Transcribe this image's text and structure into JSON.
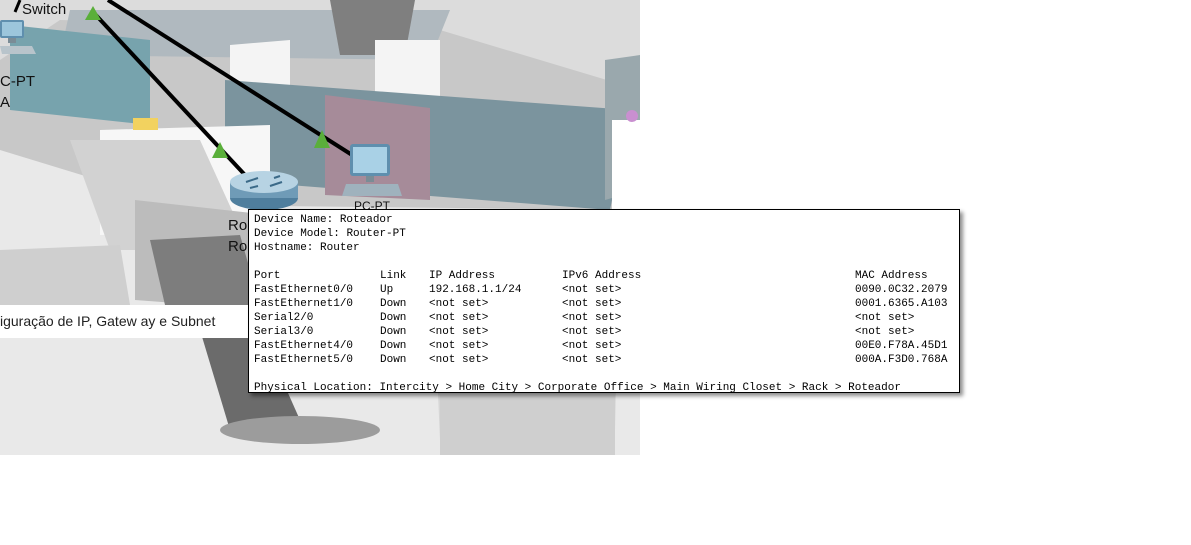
{
  "canvas": {
    "labels": {
      "switch": "Switch",
      "pc_left_line1": "C-PT",
      "pc_left_line2": "A",
      "router_line1": "Ro",
      "router_line2": "Ro",
      "pc_center": "PC-PT"
    },
    "note": "iguração de IP, Gatew ay e Subnet"
  },
  "tooltip": {
    "device_name_label": "Device Name:",
    "device_name": "Roteador",
    "device_model_label": "Device Model:",
    "device_model": "Router-PT",
    "hostname_label": "Hostname:",
    "hostname": "Router",
    "columns": {
      "port": "Port",
      "link": "Link",
      "ip": "IP Address",
      "ipv6": "IPv6 Address",
      "mac": "MAC Address"
    },
    "ports": [
      {
        "port": "FastEthernet0/0",
        "link": "Up",
        "ip": "192.168.1.1/24",
        "ipv6": "<not set>",
        "mac": "0090.0C32.2079"
      },
      {
        "port": "FastEthernet1/0",
        "link": "Down",
        "ip": "<not set>",
        "ipv6": "<not set>",
        "mac": "0001.6365.A103"
      },
      {
        "port": "Serial2/0",
        "link": "Down",
        "ip": "<not set>",
        "ipv6": "<not set>",
        "mac": "<not set>"
      },
      {
        "port": "Serial3/0",
        "link": "Down",
        "ip": "<not set>",
        "ipv6": "<not set>",
        "mac": "<not set>"
      },
      {
        "port": "FastEthernet4/0",
        "link": "Down",
        "ip": "<not set>",
        "ipv6": "<not set>",
        "mac": "00E0.F78A.45D1"
      },
      {
        "port": "FastEthernet5/0",
        "link": "Down",
        "ip": "<not set>",
        "ipv6": "<not set>",
        "mac": "000A.F3D0.768A"
      }
    ],
    "location_label": "Physical Location:",
    "location": "Intercity > Home City > Corporate Office > Main Wiring Closet > Rack > Roteador"
  }
}
